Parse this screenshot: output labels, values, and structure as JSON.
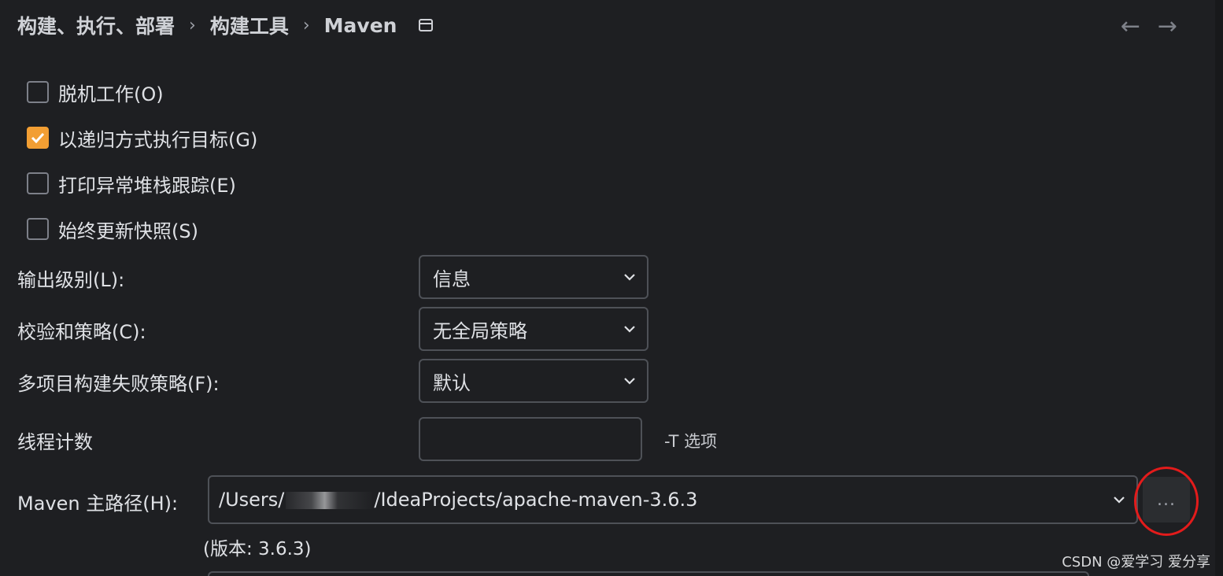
{
  "breadcrumb": {
    "items": [
      "构建、执行、部署",
      "构建工具",
      "Maven"
    ],
    "separator": "›",
    "icon": "window-icon"
  },
  "nav": {
    "back": "←",
    "forward": "→"
  },
  "checkboxes": [
    {
      "label": "脱机工作(O)",
      "checked": false
    },
    {
      "label": "以递归方式执行目标(G)",
      "checked": true
    },
    {
      "label": "打印异常堆栈跟踪(E)",
      "checked": false
    },
    {
      "label": "始终更新快照(S)",
      "checked": false
    }
  ],
  "output_level": {
    "label": "输出级别(L):",
    "value": "信息"
  },
  "checksum_policy": {
    "label": "校验和策略(C):",
    "value": "无全局策略"
  },
  "failure_policy": {
    "label": "多项目构建失败策略(F):",
    "value": "默认"
  },
  "thread_count": {
    "label": "线程计数",
    "value": "",
    "hint": "-T 选项"
  },
  "maven_home": {
    "label": "Maven 主路径(H):",
    "value_prefix": "/Users/",
    "value_suffix": "/IdeaProjects/apache-maven-3.6.3",
    "browse_label": "...",
    "version": "(版本: 3.6.3)"
  },
  "watermark": "CSDN @爱学习 爱分享",
  "colors": {
    "accent": "#f29e33",
    "highlight_circle": "#e31b1b",
    "background": "#1e1f22"
  }
}
